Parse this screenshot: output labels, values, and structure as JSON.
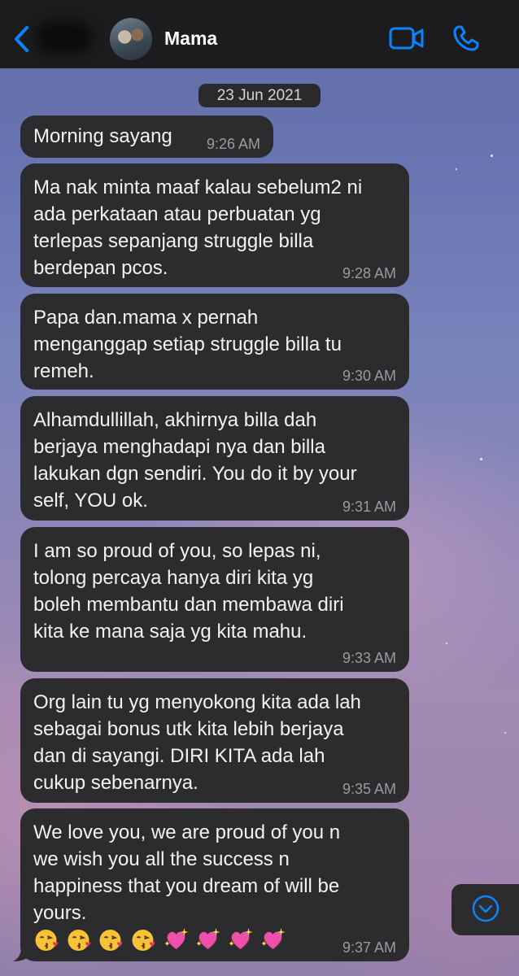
{
  "header": {
    "contact_name": "Mama",
    "accent_color": "#0a84ff",
    "icons": [
      "chevron-left-icon",
      "video-call-icon",
      "phone-icon"
    ]
  },
  "chat": {
    "date": "23 Jun 2021",
    "messages": [
      {
        "text": "Morning sayang",
        "time": "9:26 AM"
      },
      {
        "text": "Ma nak minta maaf kalau sebelum2 ni\nada perkataan atau perbuatan yg\nterlepas sepanjang struggle billa\nberdepan pcos.",
        "time": "9:28 AM"
      },
      {
        "text": "Papa dan.mama x pernah\nmenganggap setiap struggle billa tu\nremeh.",
        "time": "9:30 AM"
      },
      {
        "text": "Alhamdullillah, akhirnya billa dah\nberjaya menghadapi nya dan billa\nlakukan dgn sendiri. You do it by your\nself, YOU ok.",
        "time": "9:31 AM"
      },
      {
        "text": "I am so proud of you, so lepas ni,\ntolong percaya hanya diri kita yg\nboleh membantu dan membawa diri\nkita ke mana saja yg kita mahu.",
        "time": "9:33 AM"
      },
      {
        "text": "Org lain tu yg menyokong kita ada lah\nsebagai bonus utk kita lebih berjaya\ndan di sayangi. DIRI KITA ada lah\ncukup sebenarnya.",
        "time": "9:35 AM"
      },
      {
        "text": "We love you, we are proud of you n\nwe wish you all the success n\nhappiness that you dream of will be\nyours.",
        "time": "9:37 AM",
        "emojis": [
          "kissing-face-icon",
          "kissing-face-icon",
          "kissing-face-icon",
          "kissing-face-icon",
          "sparkling-heart-icon",
          "sparkling-heart-icon",
          "sparkling-heart-icon",
          "sparkling-heart-icon"
        ]
      }
    ]
  },
  "colors": {
    "bubble": "#2c2c2e",
    "header": "#1c1c1e",
    "timestamp": "#9a9aa0"
  }
}
